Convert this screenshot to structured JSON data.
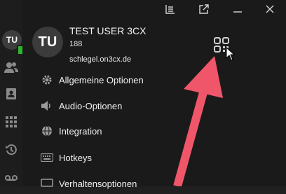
{
  "user": {
    "initials": "TU",
    "name": "TEST USER 3CX",
    "extension": "188",
    "domain": "schlegel.on3cx.de"
  },
  "menu": {
    "items": [
      {
        "label": "Allgemeine Optionen",
        "icon": "gear-icon"
      },
      {
        "label": "Audio-Optionen",
        "icon": "speaker-icon"
      },
      {
        "label": "Integration",
        "icon": "globe-icon"
      },
      {
        "label": "Hotkeys",
        "icon": "keyboard-icon"
      },
      {
        "label": "Verhaltensoptionen",
        "icon": "monitor-icon"
      }
    ]
  },
  "colors": {
    "presence": "#2db52d",
    "arrow": "#f0566a",
    "background": "#1a1a1a"
  }
}
